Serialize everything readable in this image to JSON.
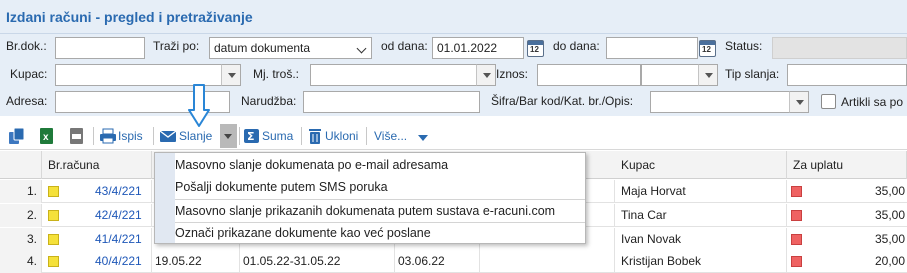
{
  "page": {
    "title": "Izdani računi - pregled i pretraživanje"
  },
  "filters": {
    "brdok_label": "Br.dok.:",
    "brdok_value": "",
    "trazi_po_label": "Traži po:",
    "trazi_po_value": "datum dokumenta",
    "od_dana_label": "od dana:",
    "od_dana_value": "01.01.2022",
    "do_dana_label": "do dana:",
    "do_dana_value": "",
    "status_label": "Status:",
    "kupac_label": "Kupac:",
    "mj_tros_label": "Mj. troš.:",
    "iznos_label": "Iznos:",
    "tip_slanja_label": "Tip slanja:",
    "adresa_label": "Adresa:",
    "narudzba_label": "Narudžba:",
    "sifra_label": "Šifra/Bar kod/Kat. br./Opis:",
    "artikli_label": "Artikli sa po"
  },
  "toolbar": {
    "ispis": "Ispis",
    "slanje": "Slanje",
    "suma": "Suma",
    "ukloni": "Ukloni",
    "vise": "Više..."
  },
  "table": {
    "headers": {
      "broj": "Br.računa",
      "kupac": "Kupac",
      "za_uplatu": "Za uplatu"
    },
    "rows": [
      {
        "n": "1.",
        "broj": "43/4/221",
        "c3": "",
        "c4": "",
        "c5": "",
        "kupac": "Maja Horvat",
        "iznos": "35,00"
      },
      {
        "n": "2.",
        "broj": "42/4/221",
        "c3": "",
        "c4": "",
        "c5": "",
        "kupac": "Tina Car",
        "iznos": "35,00"
      },
      {
        "n": "3.",
        "broj": "41/4/221",
        "c3": "",
        "c4": "",
        "c5": "",
        "kupac": "Ivan Novak",
        "iznos": "35,00"
      },
      {
        "n": "4.",
        "broj": "40/4/221",
        "c3": "19.05.22",
        "c4": "01.05.22-31.05.22",
        "c5": "03.06.22",
        "kupac": "Kristijan Bobek",
        "iznos": "20,00"
      }
    ]
  },
  "menu": {
    "items": [
      "Masovno slanje dokumenata po e-mail adresama",
      "Pošalji dokumente putem SMS poruka",
      "Masovno slanje prikazanih dokumenata putem sustava e-racuni.com",
      "Označi prikazane dokumente kao već poslane"
    ]
  },
  "colors": {
    "accent": "#2a6ab0",
    "panel": "#e6eef7",
    "status_red": "#ef6262",
    "status_yellow": "#f5e13a"
  }
}
